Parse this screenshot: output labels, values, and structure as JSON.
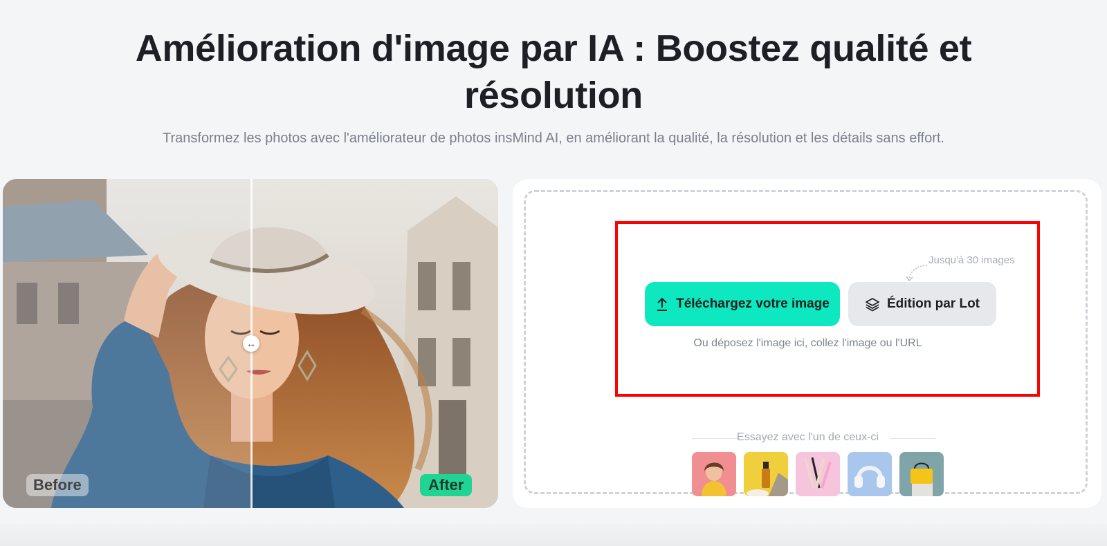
{
  "hero": {
    "title_line1": "Amélioration d'image par IA : Boostez qualité et",
    "title_line2": "résolution",
    "subtitle": "Transformez les photos avec l'améliorateur de photos insMind AI, en améliorant la qualité, la résolution et les détails sans effort."
  },
  "compare": {
    "before_label": "Before",
    "after_label": "After",
    "handle_icon": "left-right-arrows-icon",
    "split_fraction": 0.5
  },
  "upload": {
    "limit_note": "Jusqu'à 30 images",
    "upload_button": "Téléchargez votre image",
    "upload_icon": "upload-arrow-icon",
    "batch_button": "Édition par Lot",
    "batch_icon": "layers-icon",
    "drop_hint": "Ou déposez l'image ici, collez l'image ou l'URL",
    "samples_label": "Essayez avec l'un de ceux-ci",
    "samples": [
      "woman-portrait",
      "serum-bottle",
      "makeup-brushes",
      "headphones",
      "yellow-handbag"
    ]
  },
  "colors": {
    "accent": "#0de8c0",
    "after_badge": "#20d594",
    "highlight": "#ff0000",
    "secondary_button": "#e6e8eb"
  }
}
